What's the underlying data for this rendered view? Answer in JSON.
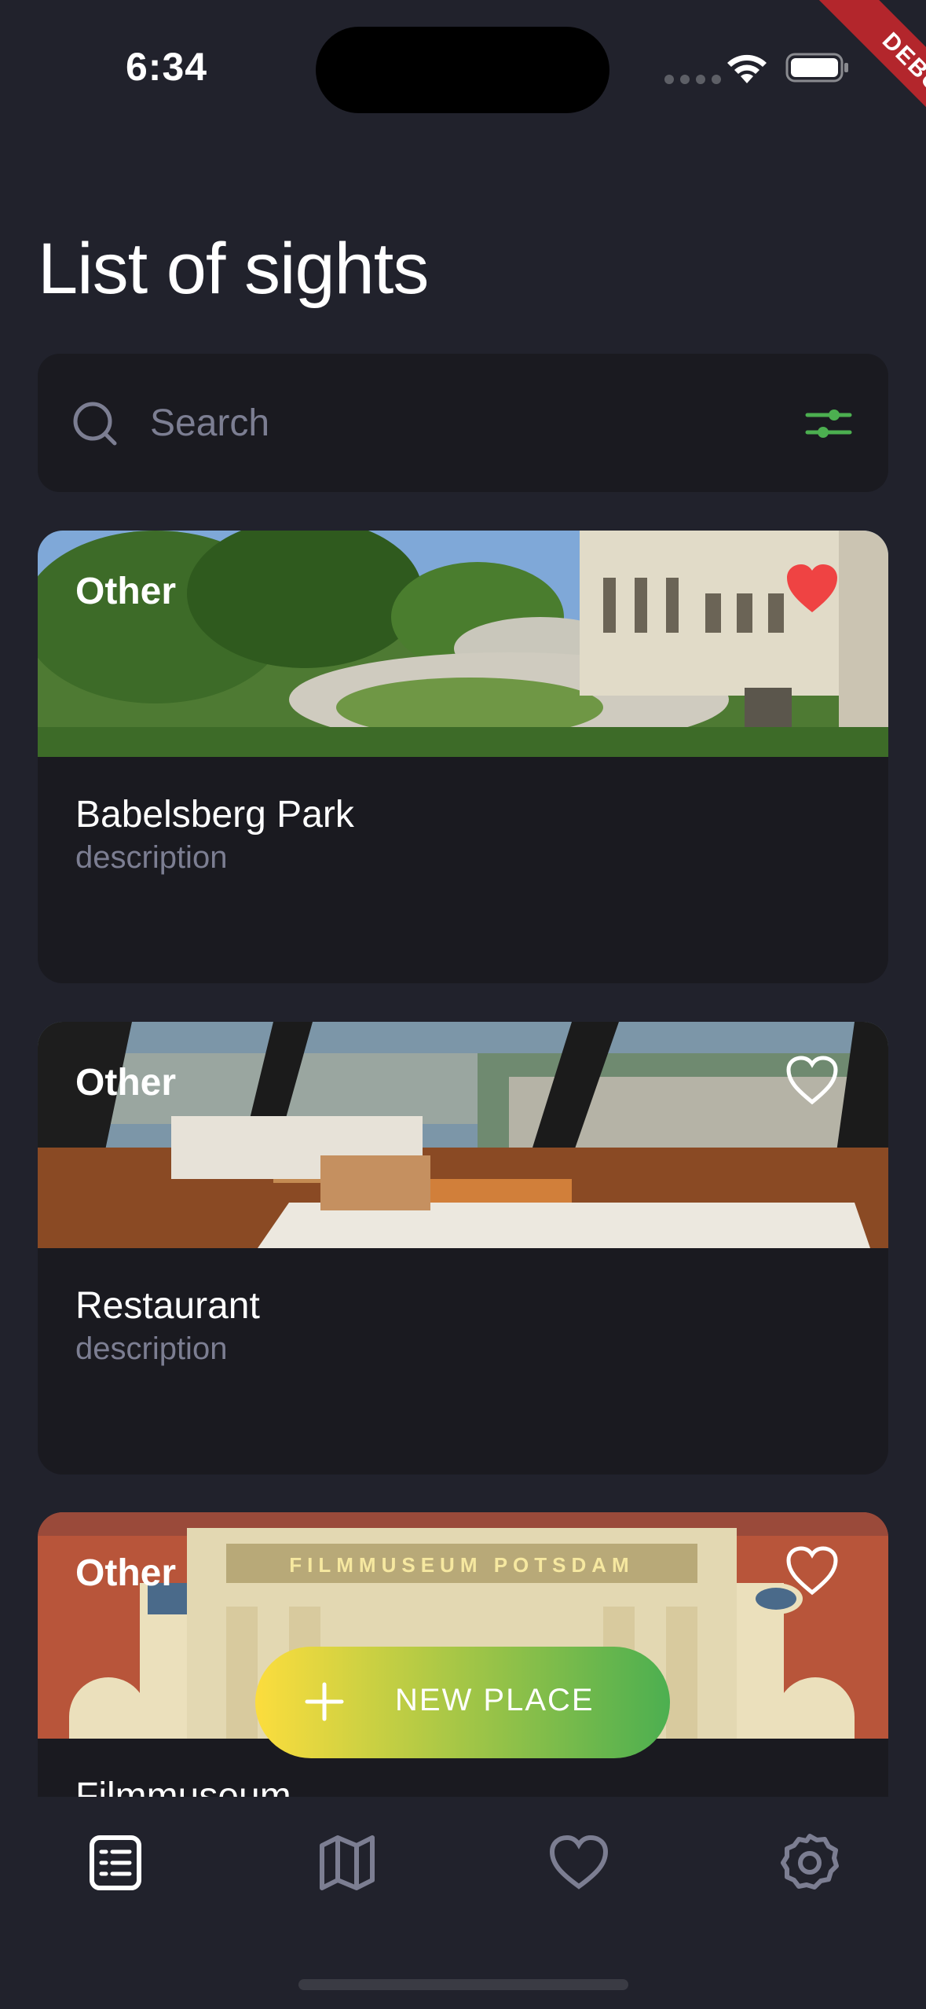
{
  "status_bar": {
    "time": "6:34",
    "debug_label": "DEBUG"
  },
  "title": "List of sights",
  "search": {
    "placeholder": "Search",
    "value": ""
  },
  "colors": {
    "background": "#21222C",
    "card": "#1A1A20",
    "accent_green": "#4CAF50",
    "accent_yellow": "#FCDD3D",
    "favorite_red": "#EF4343",
    "secondary_text": "#7C7E92"
  },
  "places": [
    {
      "category": "Other",
      "name": "Babelsberg Park",
      "description": "description",
      "favorite": true,
      "image": "park-castle-photo"
    },
    {
      "category": "Other",
      "name": "Restaurant",
      "description": "description",
      "favorite": false,
      "image": "panorama-restaurant-photo"
    },
    {
      "category": "Other",
      "name": "Filmmuseum",
      "description": "description",
      "favorite": false,
      "image": "filmmuseum-facade-photo",
      "image_sign_text": "FILMMUSEUM POTSDAM"
    }
  ],
  "fab": {
    "label": "NEW PLACE",
    "icon": "plus-icon"
  },
  "bottom_nav": [
    {
      "icon": "list-icon",
      "active": true
    },
    {
      "icon": "map-icon",
      "active": false
    },
    {
      "icon": "heart-icon",
      "active": false
    },
    {
      "icon": "settings-icon",
      "active": false
    }
  ]
}
